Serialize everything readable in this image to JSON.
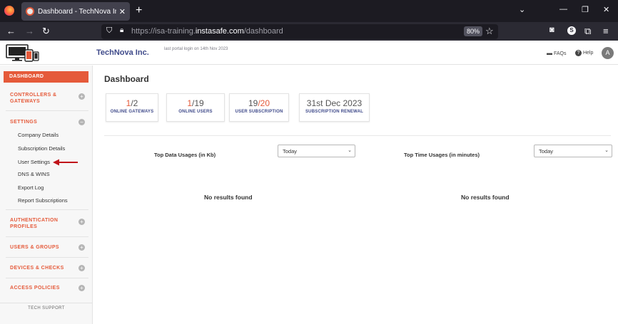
{
  "browser": {
    "tab_title": "Dashboard - TechNova Inc. | Inc",
    "url_prefix": "https://isa-training.",
    "url_domain": "instasafe.com",
    "url_path": "/dashboard",
    "zoom": "80%"
  },
  "header": {
    "brand": "TechNova Inc.",
    "last_login": "last portal login on 14th Nov 2023",
    "faqs": "FAQs",
    "help": "Help",
    "avatar_letter": "A"
  },
  "sidebar": {
    "active": "DASHBOARD",
    "sections": [
      {
        "label": "CONTROLLERS & GATEWAYS",
        "toggle": "+"
      },
      {
        "label": "SETTINGS",
        "toggle": "−"
      },
      {
        "label": "AUTHENTICATION PROFILES",
        "toggle": "+"
      },
      {
        "label": "USERS & GROUPS",
        "toggle": "+"
      },
      {
        "label": "DEVICES & CHECKS",
        "toggle": "+"
      },
      {
        "label": "ACCESS POLICIES",
        "toggle": "+"
      }
    ],
    "settings_items": [
      "Company Details",
      "Subscription Details",
      "User Settings",
      "DNS & WINS",
      "Export Log",
      "Report Subscriptions"
    ],
    "footer": "TECH SUPPORT"
  },
  "main": {
    "title": "Dashboard",
    "cards": [
      {
        "num": "1",
        "den": "/2",
        "label": "ONLINE GATEWAYS"
      },
      {
        "num": "1",
        "den": "/19",
        "label": "ONLINE USERS"
      },
      {
        "num": "19",
        "den": "/20",
        "label": "USER SUBSCRIPTION"
      },
      {
        "num": "",
        "den": "31st Dec 2023",
        "label": "SUBSCRIPTION RENEWAL"
      }
    ],
    "widgets": [
      {
        "title": "Top Data Usages (in Kb)",
        "select": "Today",
        "empty": "No results found"
      },
      {
        "title": "Top Time Usages (in minutes)",
        "select": "Today",
        "empty": "No results found"
      }
    ]
  },
  "colors": {
    "accent": "#e55a3a",
    "brand": "#3f4a8a"
  }
}
